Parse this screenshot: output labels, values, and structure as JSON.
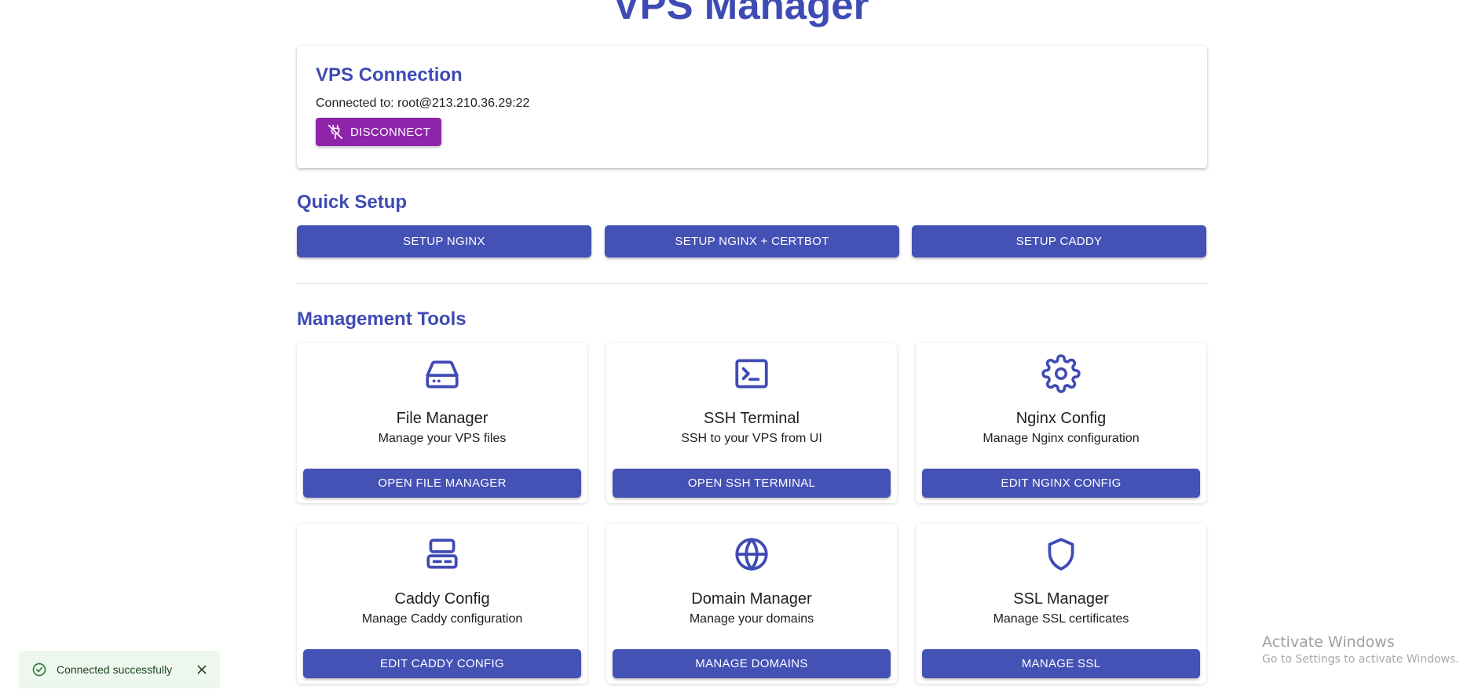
{
  "app": {
    "title": "VPS Manager"
  },
  "connection": {
    "title": "VPS Connection",
    "status_text": "Connected to: root@213.210.36.29:22",
    "disconnect_label": "DISCONNECT",
    "disconnect_icon": "plug-off-icon",
    "disconnect_color": "#8e24aa"
  },
  "quick_setup": {
    "title": "Quick Setup",
    "buttons": [
      {
        "label": "SETUP NGINX"
      },
      {
        "label": "SETUP NGINX + CERTBOT"
      },
      {
        "label": "SETUP CADDY"
      }
    ]
  },
  "management": {
    "title": "Management Tools",
    "tools": [
      {
        "icon": "hard-drive-icon",
        "name": "File Manager",
        "desc": "Manage your VPS files",
        "button": "OPEN FILE MANAGER"
      },
      {
        "icon": "terminal-icon",
        "name": "SSH Terminal",
        "desc": "SSH to your VPS from UI",
        "button": "OPEN SSH TERMINAL"
      },
      {
        "icon": "gear-icon",
        "name": "Nginx Config",
        "desc": "Manage Nginx configuration",
        "button": "EDIT NGINX CONFIG"
      },
      {
        "icon": "server-icon",
        "name": "Caddy Config",
        "desc": "Manage Caddy configuration",
        "button": "EDIT CADDY CONFIG"
      },
      {
        "icon": "globe-icon",
        "name": "Domain Manager",
        "desc": "Manage your domains",
        "button": "MANAGE DOMAINS"
      },
      {
        "icon": "shield-icon",
        "name": "SSL Manager",
        "desc": "Manage SSL certificates",
        "button": "MANAGE SSL"
      }
    ]
  },
  "toast": {
    "message": "Connected successfully",
    "icon": "check-circle-icon",
    "close_icon": "close-icon"
  },
  "watermark": {
    "line1": "Activate Windows",
    "line2": "Go to Settings to activate Windows."
  },
  "colors": {
    "primary": "#4451b5",
    "heading": "#3f4bb4",
    "toast_bg": "#edf7ed",
    "toast_icon": "#2e7d32"
  }
}
